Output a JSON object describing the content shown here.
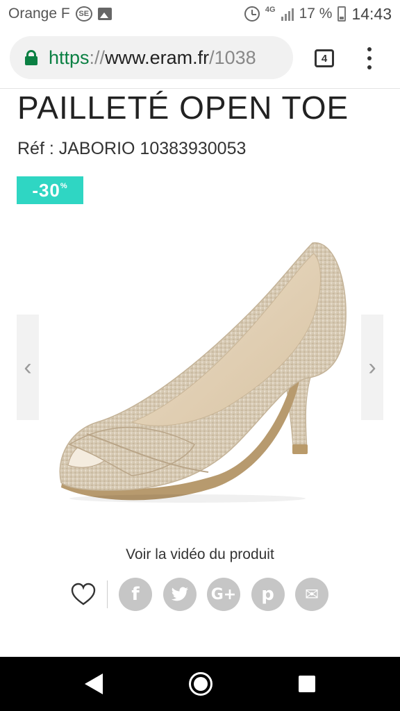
{
  "status_bar": {
    "carrier": "Orange F",
    "network": "4G",
    "battery": "17 %",
    "time": "14:43"
  },
  "browser": {
    "url_scheme": "https",
    "url_sep": "://",
    "url_host": "www.eram.fr",
    "url_path": "/1038",
    "tab_count": "4"
  },
  "product": {
    "title": "PAILLETÉ OPEN TOE",
    "reference": "Réf : JABORIO 10383930053",
    "discount": "-30",
    "discount_unit": "%",
    "video_link": "Voir la vidéo du produit"
  },
  "carousel": {
    "prev_glyph": "‹",
    "next_glyph": "›"
  },
  "share": {
    "facebook": "f",
    "twitter": "t",
    "google": "G+",
    "pinterest": "p",
    "email": "✉"
  },
  "colors": {
    "discount_badge": "#2fd6c3",
    "secure_green": "#0b8043",
    "social_grey": "#c6c6c6"
  }
}
